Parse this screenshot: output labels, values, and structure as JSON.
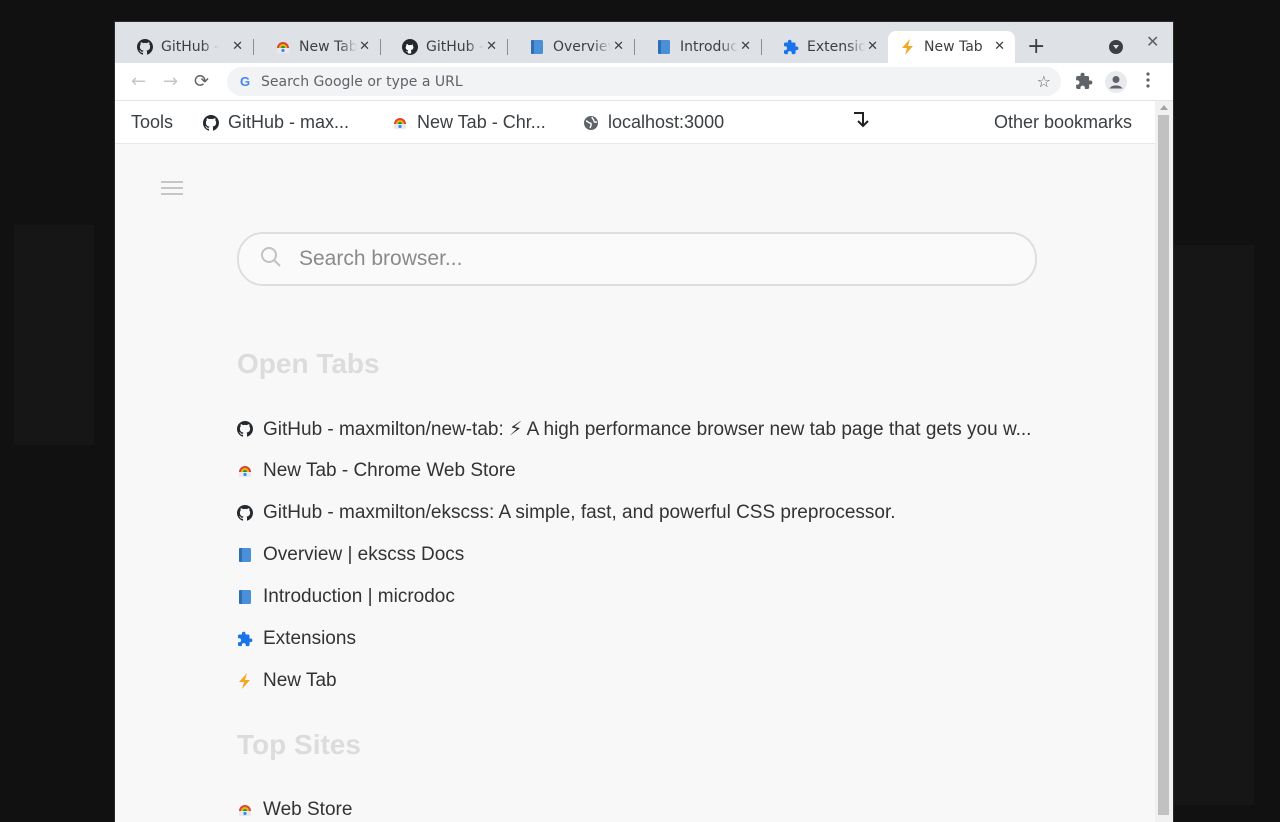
{
  "browser": {
    "tabs": [
      {
        "title": "GitHub - maxmilton/new-tab",
        "icon": "github-icon",
        "active": false
      },
      {
        "title": "New Tab - Chrome Web Store",
        "icon": "webstore-icon",
        "active": false
      },
      {
        "title": "GitHub - maxmilton/ekscss",
        "icon": "github-icon",
        "active": false
      },
      {
        "title": "Overview | ekscss Docs",
        "icon": "book-icon",
        "active": false
      },
      {
        "title": "Introduction | microdoc",
        "icon": "book-icon",
        "active": false
      },
      {
        "title": "Extensions",
        "icon": "puzzle-icon",
        "active": false
      },
      {
        "title": "New Tab",
        "icon": "lightning-icon",
        "active": true
      }
    ],
    "omnibox_placeholder": "Search Google or type a URL"
  },
  "bookmarks_bar": {
    "items": [
      {
        "label": "Tools",
        "icon": ""
      },
      {
        "label": "GitHub - max...",
        "icon": "github-icon"
      },
      {
        "label": "New Tab - Chr...",
        "icon": "webstore-icon"
      },
      {
        "label": "localhost:3000",
        "icon": "globe-icon"
      }
    ],
    "other_label": "Other bookmarks"
  },
  "newtab": {
    "search_placeholder": "Search browser...",
    "open_tabs_title": "Open Tabs",
    "open_tabs": [
      {
        "label": "GitHub - maxmilton/new-tab: ⚡ A high performance browser new tab page that gets you w...",
        "icon": "github-icon"
      },
      {
        "label": "New Tab - Chrome Web Store",
        "icon": "webstore-icon"
      },
      {
        "label": "GitHub - maxmilton/ekscss: A simple, fast, and powerful CSS preprocessor.",
        "icon": "github-icon"
      },
      {
        "label": "Overview | ekscss Docs",
        "icon": "book-icon"
      },
      {
        "label": "Introduction | microdoc",
        "icon": "book-icon"
      },
      {
        "label": "Extensions",
        "icon": "puzzle-icon"
      },
      {
        "label": "New Tab",
        "icon": "lightning-icon"
      }
    ],
    "top_sites_title": "Top Sites",
    "top_sites": [
      {
        "label": "Web Store",
        "icon": "webstore-icon"
      }
    ]
  },
  "colors": {
    "accent_blue": "#4a90d9",
    "lightning": "#f5a623",
    "section_title": "#dcdcdc"
  }
}
